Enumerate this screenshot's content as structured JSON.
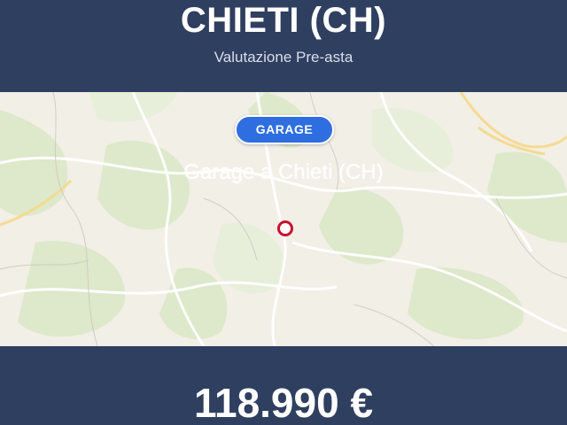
{
  "header": {
    "title": "CHIETI (CH)",
    "subtitle": "Valutazione Pre-asta"
  },
  "map": {
    "badge_label": "GARAGE",
    "caption": "Garage a Chieti (CH)",
    "marker_icon": "location-pin-icon"
  },
  "footer": {
    "price": "118.990 €"
  },
  "colors": {
    "header_bg": "#2f3f60",
    "badge_bg": "#2e6ee0",
    "marker": "#c8102e"
  }
}
